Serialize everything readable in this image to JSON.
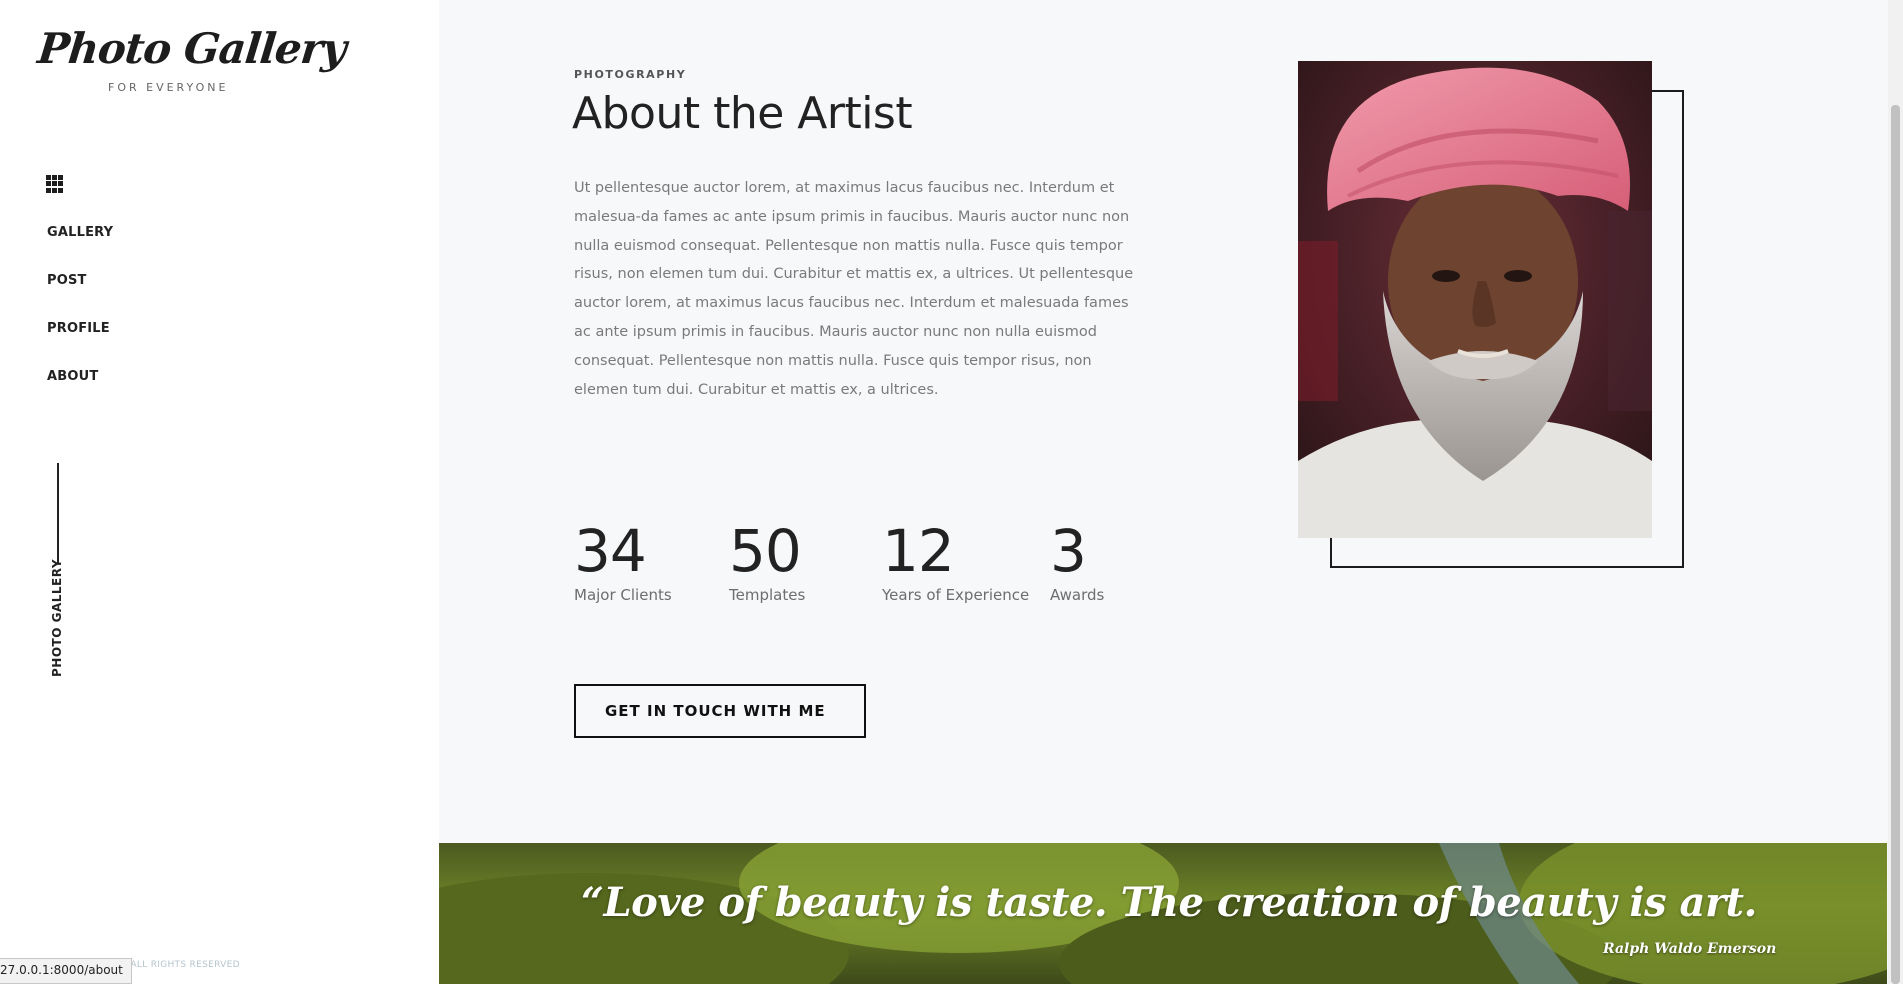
{
  "brand": {
    "logo_text": "Photo Gallery",
    "tagline": "FOR EVERYONE"
  },
  "nav": {
    "items": [
      "GALLERY",
      "POST",
      "PROFILE",
      "ABOUT"
    ]
  },
  "sidebar": {
    "vertical_label": "PHOTO GALLERY",
    "copyright": "© ALL RIGHTS RESERVED"
  },
  "status_bar": {
    "url": "27.0.0.1:8000/about"
  },
  "about": {
    "eyebrow": "PHOTOGRAPHY",
    "title": "About the Artist",
    "bio": "Ut pellentesque auctor lorem, at maximus lacus faucibus nec. Interdum et malesua-da fames ac ante ipsum primis in faucibus. Mauris auctor nunc non nulla euismod consequat. Pellentesque non mattis nulla. Fusce quis tempor risus, non elemen tum dui. Curabitur et mattis ex, a ultrices. Ut pellentesque auctor lorem, at maximus lacus faucibus nec. Interdum et malesuada fames ac ante ipsum primis in faucibus. Mauris auctor nunc non nulla euismod consequat. Pellentesque non mattis nulla. Fusce quis tempor risus, non elemen tum dui. Curabitur et mattis ex, a ultrices."
  },
  "stats": [
    {
      "value": "34",
      "label": "Major Clients"
    },
    {
      "value": "50",
      "label": "Templates"
    },
    {
      "value": "12",
      "label": "Years of Experience"
    },
    {
      "value": "3",
      "label": "Awards"
    }
  ],
  "cta": {
    "label": "GET IN TOUCH WITH ME"
  },
  "banner": {
    "quote": "“Love of beauty is taste. The creation of beauty is art.",
    "author": "Ralph Waldo Emerson"
  },
  "colors": {
    "sidebar_bg": "#ffffff",
    "main_bg": "#f7f8fa",
    "text_dark": "#222222",
    "text_muted": "#7a7a7a",
    "turban_pink": "#e07b8f"
  }
}
